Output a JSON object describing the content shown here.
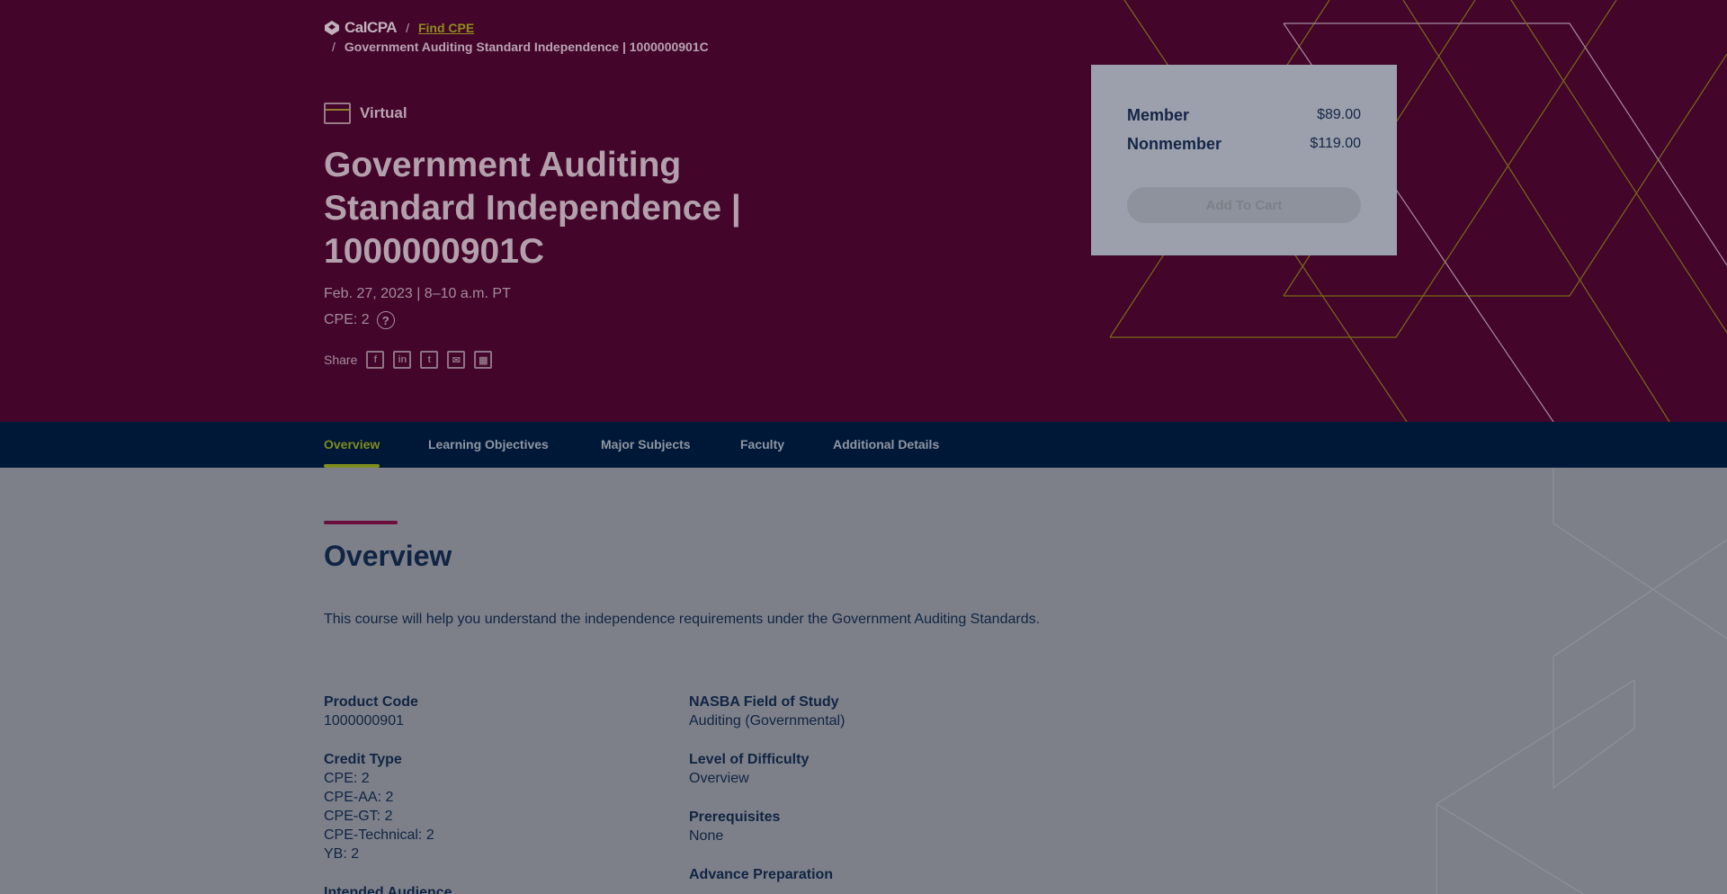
{
  "breadcrumb": {
    "logo": "CalCPA",
    "link": "Find CPE",
    "current": "Government Auditing Standard Independence | 1000000901C"
  },
  "course": {
    "format_icon": "calendar-window-icon",
    "format": "Virtual",
    "title": "Government Auditing Standard Independence | 1000000901C",
    "date": "Feb. 27, 2023 | 8–10 a.m. PT",
    "cpe": "CPE: 2",
    "share_label": "Share",
    "share_icons": [
      "facebook-icon",
      "linkedin-icon",
      "twitter-icon",
      "email-icon",
      "calendar-icon"
    ]
  },
  "pricing": {
    "member_label": "Member",
    "member_price": "$89.00",
    "nonmember_label": "Nonmember",
    "nonmember_price": "$119.00",
    "cart_button": "Add To Cart"
  },
  "tabs": [
    {
      "label": "Overview",
      "active": true
    },
    {
      "label": "Learning Objectives",
      "active": false
    },
    {
      "label": "Major Subjects",
      "active": false
    },
    {
      "label": "Faculty",
      "active": false
    },
    {
      "label": "Additional Details",
      "active": false
    }
  ],
  "overview": {
    "heading": "Overview",
    "description": "This course will help you understand the independence requirements under the Government Auditing Standards.",
    "details_left": [
      {
        "label": "Product Code",
        "values": [
          "1000000901"
        ]
      },
      {
        "label": "Credit Type",
        "values": [
          "CPE: 2",
          "CPE-AA: 2",
          "CPE-GT: 2",
          "CPE-Technical: 2",
          "YB: 2"
        ]
      },
      {
        "label": "Intended Audience",
        "values": []
      }
    ],
    "details_right": [
      {
        "label": "NASBA Field of Study",
        "values": [
          "Auditing (Governmental)"
        ]
      },
      {
        "label": "Level of Difficulty",
        "values": [
          "Overview"
        ]
      },
      {
        "label": "Prerequisites",
        "values": [
          "None"
        ]
      },
      {
        "label": "Advance Preparation",
        "values": []
      }
    ]
  },
  "colors": {
    "hero": "#43052a",
    "nav": "#001838",
    "accent": "#7e8c1e",
    "text": "#102444"
  }
}
